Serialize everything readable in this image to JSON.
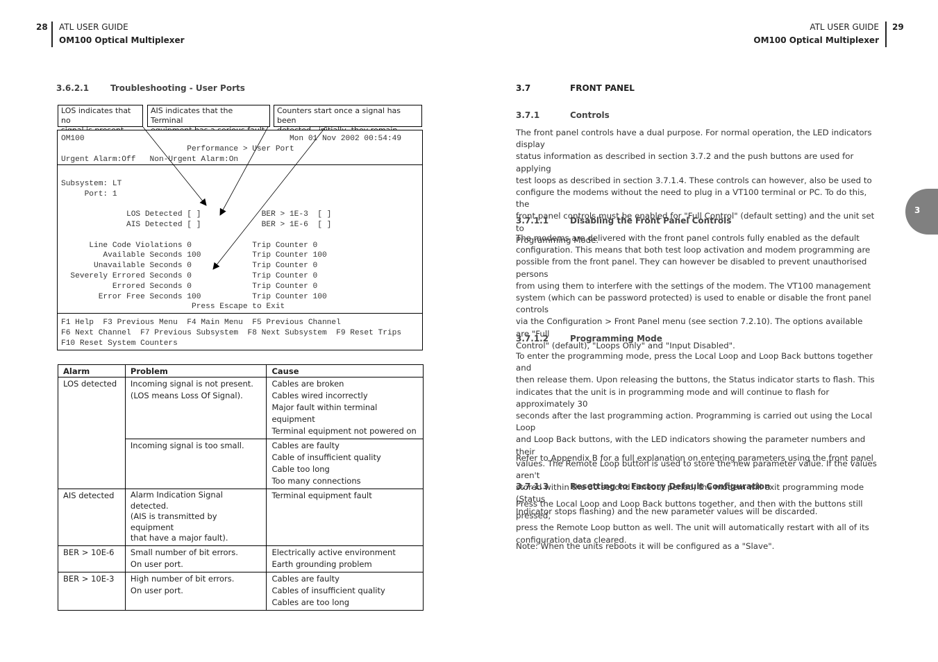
{
  "left_page": {
    "page_number": "28",
    "header_title": "ATL USER GUIDE",
    "header_subtitle": "OM100 Optical Multiplexer",
    "section": {
      "number": "3.6.2.1",
      "title": "Troubleshooting - User Ports"
    },
    "callouts": [
      {
        "lines": [
          "LOS indicates that no",
          "signal is present"
        ]
      },
      {
        "lines": [
          "AIS indicates that the Terminal",
          "equipment has a serious fault"
        ]
      },
      {
        "lines": [
          "Counters start once a signal has been",
          "detected - initially, they remain frozen."
        ]
      }
    ],
    "terminal": {
      "header_lines": [
        "OM100                                            Mon 01 Nov 2002 00:54:49",
        "                           Performance > User Port",
        "Urgent Alarm:Off   Non-Urgent Alarm:On"
      ],
      "body_lines": [
        "",
        "Subsystem: LT",
        "     Port: 1",
        "",
        "              LOS Detected [ ]             BER > 1E-3  [ ]",
        "              AIS Detected [ ]             BER > 1E-6  [ ]",
        "",
        "      Line Code Violations 0             Trip Counter 0",
        "         Available Seconds 100           Trip Counter 100",
        "       Unavailable Seconds 0             Trip Counter 0",
        "  Severely Errored Seconds 0             Trip Counter 0",
        "           Errored Seconds 0             Trip Counter 0",
        "        Error Free Seconds 100           Trip Counter 100",
        "                            Press Escape to Exit"
      ],
      "footer_lines": [
        "F1 Help  F3 Previous Menu  F4 Main Menu  F5 Previous Channel",
        "F6 Next Channel  F7 Previous Subsystem  F8 Next Subsystem  F9 Reset Trips",
        "F10 Reset System Counters"
      ]
    },
    "alarm_table": {
      "headers": [
        "Alarm",
        "Problem",
        "Cause"
      ],
      "rows": [
        {
          "alarm": "LOS detected",
          "problem": [
            "Incoming signal is not present.",
            "(LOS means Loss Of Signal)."
          ],
          "cause": [
            "Cables are broken",
            "Cables wired incorrectly",
            "Major fault within terminal equipment",
            "Terminal equipment not powered on"
          ]
        },
        {
          "alarm": "",
          "problem": [
            "Incoming signal is too small."
          ],
          "cause": [
            "Cables are faulty",
            "Cable of insufficient quality",
            "Cable too long",
            "Too many connections"
          ]
        },
        {
          "alarm": "AIS detected",
          "problem": [
            "Alarm Indication Signal detected.",
            "(AIS is transmitted by equipment",
            "that have a major fault)."
          ],
          "cause": [
            "Terminal equipment fault"
          ]
        },
        {
          "alarm": "BER > 10E-6",
          "problem": [
            "Small number of bit errors.",
            "On user port."
          ],
          "cause": [
            "Electrically active environment",
            "Earth grounding problem"
          ]
        },
        {
          "alarm": "BER > 10E-3",
          "problem": [
            "High number of bit errors.",
            "On user port."
          ],
          "cause": [
            "Cables are faulty",
            "Cables of insufficient quality",
            "Cables are too long"
          ]
        }
      ]
    }
  },
  "right_page": {
    "page_number": "29",
    "header_title": "ATL USER GUIDE",
    "header_subtitle": "OM100 Optical Multiplexer",
    "chapter_tab": "3",
    "sections": [
      {
        "number": "3.7",
        "title": "FRONT PANEL",
        "paragraphs": []
      },
      {
        "number": "3.7.1",
        "title": "Controls",
        "paragraphs": [
          [
            "The front panel controls have a dual purpose.  For normal operation, the LED indicators display",
            "status information as described in section 3.7.2 and the push buttons are used for applying",
            "test loops as described in section 3.7.1.4.  These controls can however, also be used to",
            "configure the modems without the need to plug in a VT100 terminal or PC.  To do this, the",
            "front panel controls must be enabled for \"Full Control\" (default setting) and the unit set to",
            "Programming Mode."
          ]
        ]
      },
      {
        "number": "3.7.1.1",
        "title": "Disabling the Front Panel Controls",
        "paragraphs": [
          [
            "The modems are delivered with the front panel controls fully enabled as the default",
            "configuration.  This means that both test loop activation and modem programming are",
            "possible from the front panel.  They can however be disabled to prevent unauthorised persons",
            "from using them to interfere with the settings of the modem.  The VT100 management",
            "system (which can be password protected) is used to enable or disable the front panel controls",
            "via the Configuration > Front Panel menu (see section 7.2.10).  The options available are \"Full",
            "Control\" (default), \"Loops Only\" and \"Input Disabled\"."
          ]
        ]
      },
      {
        "number": "3.7.1.2",
        "title": "Programming Mode",
        "paragraphs": [
          [
            "To enter the programming mode, press the Local Loop and Loop Back buttons together and",
            "then release them.  Upon releasing the buttons, the Status indicator starts to flash.  This",
            "indicates that the unit is in programming mode and will continue to flash for approximately 30",
            "seconds after the last programming action.  Programming is carried out using the Local Loop",
            "and Loop Back buttons, with the LED indicators showing the parameter numbers and their",
            "values. The Remote Loop button is used to store the new parameter value.  If the values aren't",
            "stored within the 30 second timeout period, the modem will exit programming mode (Status",
            "Indicator stops flashing) and the new parameter values will be discarded."
          ],
          [
            "Refer to Appendix B for a full explanation on entering parameters using the front panel"
          ]
        ]
      },
      {
        "number": "3.7.1.3",
        "title": "Resetting to Factory Default Configuration",
        "paragraphs": [
          [
            "Press the Local Loop and Loop Back buttons together, and then with the buttons still pressed,",
            "press the Remote Loop button as well. The unit will automatically restart with all of its",
            "configuration data cleared."
          ],
          [
            "Note: When the units reboots it will be configured as a \"Slave\"."
          ]
        ]
      }
    ]
  }
}
